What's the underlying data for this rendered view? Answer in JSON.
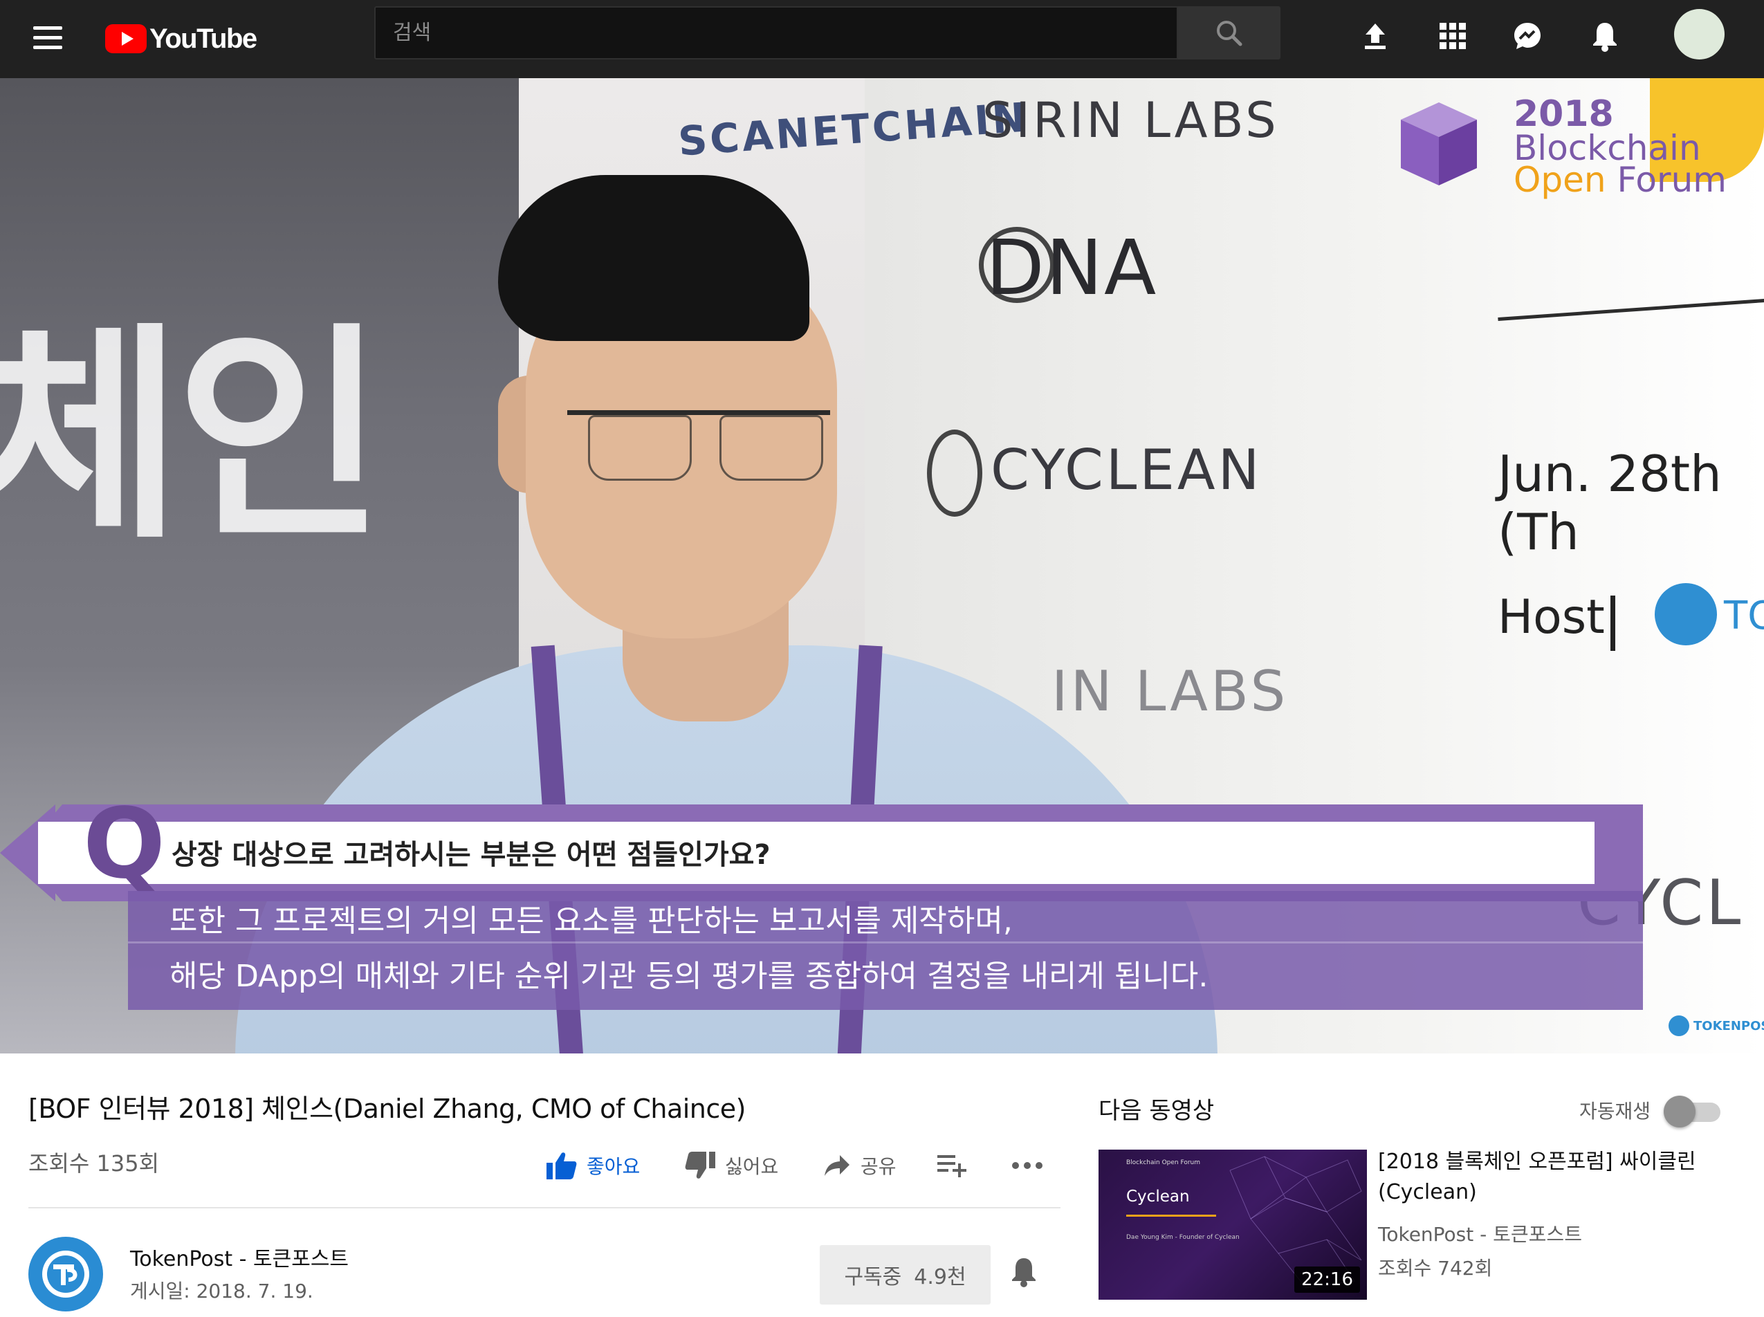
{
  "header": {
    "logo_text": "YouTube",
    "search_placeholder": "검색",
    "icons": [
      "menu-icon",
      "upload-icon",
      "apps-icon",
      "messages-icon",
      "notifications-icon",
      "account-avatar"
    ]
  },
  "video": {
    "overlay": {
      "question_mark": "Q",
      "question": "상장 대상으로 고려하시는 부분은 어떤 점들인가요?",
      "answer_line1": "또한 그 프로젝트의 거의 모든 요소를 판단하는 보고서를 제작하며,",
      "answer_line2": "해당 DApp의 매체와 기타 순위 기관 등의 평가를 종합하여 결정을 내리게 됩니다.",
      "watermark": "TOKENPOST"
    },
    "backdrop": {
      "korean_left": "체인",
      "scanetchain": "SCANETCHAIN",
      "sirin": "SIRIN LABS",
      "dna": "DNA",
      "cyclean": "CYCLEAN",
      "labs": "IN LABS",
      "cyclean_right": "CYCL",
      "bof_year": "2018",
      "bof_line1": "Blockchain",
      "bof_line2_a": "Open",
      "bof_line2_b": " Forum",
      "date": "Jun. 28th (Th",
      "host": "Host",
      "host_logo": "TO"
    }
  },
  "info": {
    "title": "[BOF 인터뷰 2018] 체인스(Daniel Zhang, CMO of Chaince)",
    "views": "조회수 135회",
    "like_label": "좋아요",
    "dislike_label": "싫어요",
    "share_label": "공유",
    "channel_name": "TokenPost - 토큰포스트",
    "publish_date": "게시일: 2018. 7. 19.",
    "subscribed_label": "구독중",
    "subscriber_count": "4.9천"
  },
  "upnext": {
    "label": "다음 동영상",
    "autoplay_label": "자동재생",
    "autoplay_on": false,
    "video": {
      "title": "[2018 블록체인 오픈포럼] 싸이클린(Cyclean)",
      "channel": "TokenPost - 토큰포스트",
      "views": "조회수 742회",
      "duration": "22:16",
      "thumb_badge": "Blockchain Open Forum",
      "thumb_title": "Cyclean",
      "thumb_subtitle": "Dae Young Kim - Founder of Cyclean"
    }
  },
  "colors": {
    "header_bg": "#212121",
    "brand_red": "#ff0000",
    "like_blue": "#065fd4",
    "overlay_purple": "#8b6bb5",
    "tokenpost_blue": "#2a8cd3"
  }
}
